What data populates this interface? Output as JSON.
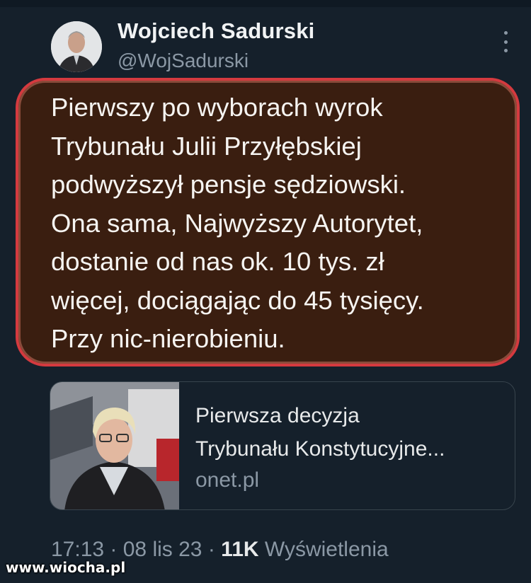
{
  "author": {
    "name": "Wojciech Sadurski",
    "handle": "@WojSadurski"
  },
  "tweet": {
    "text": "Pierwszy po wyborach wyrok\nTrybunału Julii Przyłębskiej\npodwyższył pensje sędziowski.\nOna sama, Najwyższy Autorytet,\ndostanie od nas ok. 10 tys. zł\nwięcej, dociągając do 45 tysięcy.\nPrzy nic-nierobieniu."
  },
  "link_card": {
    "title_line1": "Pierwsza decyzja",
    "title_line2": "Trybunału Konstytucyjne...",
    "domain": "onet.pl"
  },
  "meta": {
    "time": "17:13",
    "sep1": " · ",
    "date": "08 lis 23",
    "sep2": " · ",
    "views_count": "11K",
    "views_label": " Wyświetlenia"
  },
  "watermark": "www.wiocha.pl",
  "icons": {
    "more": "more-vertical-icon"
  },
  "colors": {
    "background": "#15202b",
    "bubble_fill": "#3a1e10",
    "bubble_border": "#d43a3f",
    "secondary_text": "#8b98a5"
  }
}
